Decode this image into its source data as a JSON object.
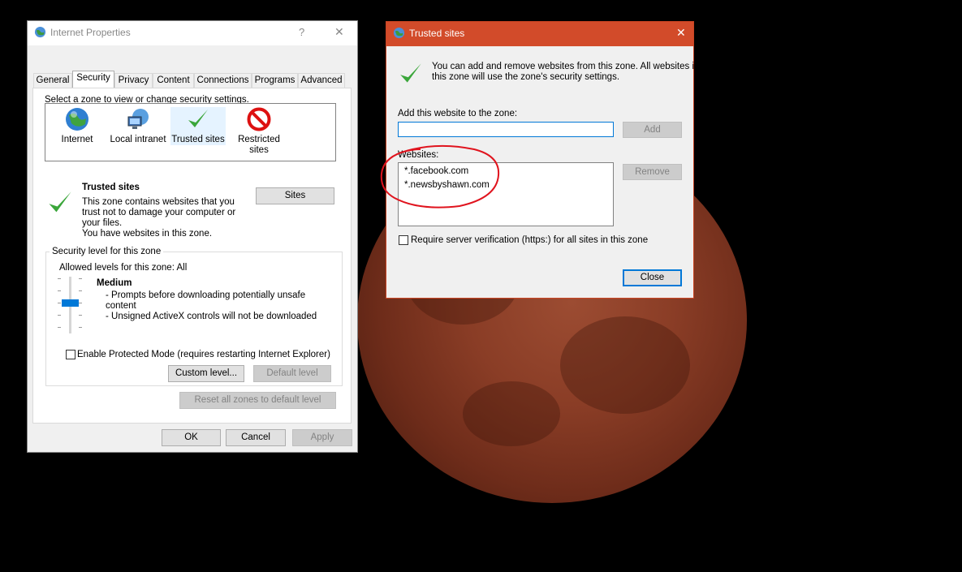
{
  "internet_properties": {
    "title": "Internet Properties",
    "help_glyph": "?",
    "close_glyph": "✕",
    "tabs": [
      "General",
      "Security",
      "Privacy",
      "Content",
      "Connections",
      "Programs",
      "Advanced"
    ],
    "active_tab": "Security",
    "zone_prompt": "Select a zone to view or change security settings.",
    "zones": [
      {
        "label": "Internet",
        "icon": "globe-icon"
      },
      {
        "label": "Local intranet",
        "icon": "network-icon"
      },
      {
        "label": "Trusted sites",
        "icon": "checkmark-icon"
      },
      {
        "label": "Restricted sites",
        "icon": "prohibited-icon"
      }
    ],
    "zone_title": "Trusted sites",
    "zone_desc_lines": [
      "This zone contains websites that you",
      "trust not to damage your computer or",
      "your files.",
      "You have websites in this zone."
    ],
    "sites_button": "Sites",
    "security_level_group": "Security level for this zone",
    "allowed_levels": "Allowed levels for this zone: All",
    "level_name": "Medium",
    "level_desc_lines": [
      "- Prompts before downloading potentially unsafe",
      "content",
      "- Unsigned ActiveX controls will not be downloaded"
    ],
    "protected_mode_label": "Enable Protected Mode (requires restarting Internet Explorer)",
    "custom_level_button": "Custom level...",
    "default_level_button": "Default level",
    "reset_zones_button": "Reset all zones to default level",
    "ok_button": "OK",
    "cancel_button": "Cancel",
    "apply_button": "Apply"
  },
  "trusted_sites": {
    "title": "Trusted sites",
    "close_glyph": "✕",
    "info_lines": [
      "You can add and remove websites from this zone. All websites in",
      "this zone will use the zone's security settings."
    ],
    "add_label": "Add this website to the zone:",
    "add_input_value": "",
    "add_button": "Add",
    "websites_label": "Websites:",
    "websites": [
      "*.facebook.com",
      "*.newsbyshawn.com"
    ],
    "remove_button": "Remove",
    "require_https_label": "Require server verification (https:) for all sites in this zone",
    "close_button": "Close"
  },
  "colors": {
    "titlebar_active": "#d24b2a",
    "annotation_red": "#e0141e",
    "check_green": "#3aa63a"
  }
}
